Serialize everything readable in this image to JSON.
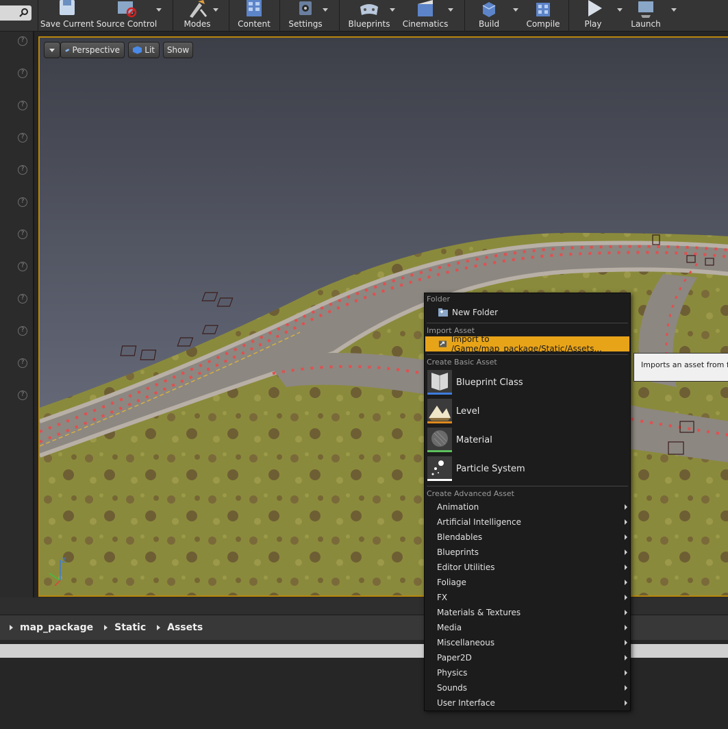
{
  "toolbar": {
    "buttons": [
      {
        "label": "Save Current"
      },
      {
        "label": "Source Control"
      },
      {
        "label": "Modes"
      },
      {
        "label": "Content"
      },
      {
        "label": "Settings"
      },
      {
        "label": "Blueprints"
      },
      {
        "label": "Cinematics"
      },
      {
        "label": "Build"
      },
      {
        "label": "Compile"
      },
      {
        "label": "Play"
      },
      {
        "label": "Launch"
      }
    ]
  },
  "left_panel": {
    "help_glyph": "?"
  },
  "viewport": {
    "view_mode_label": "Perspective",
    "lighting_label": "Lit",
    "show_label": "Show",
    "axis_z_label": "Z"
  },
  "breadcrumb": {
    "items": [
      "map_package",
      "Static",
      "Assets"
    ]
  },
  "context_menu": {
    "folder_heading": "Folder",
    "new_folder_label": "New Folder",
    "import_heading": "Import Asset",
    "import_label": "Import to /Game/map_package/Static/Assets...",
    "basic_heading": "Create Basic Asset",
    "basic_items": [
      {
        "label": "Blueprint Class",
        "bar_color": "#3d7ce0"
      },
      {
        "label": "Level",
        "bar_color": "#e08a1c"
      },
      {
        "label": "Material",
        "bar_color": "#5cc15c"
      },
      {
        "label": "Particle System",
        "bar_color": "#ffffff"
      }
    ],
    "advanced_heading": "Create Advanced Asset",
    "advanced_items": [
      "Animation",
      "Artificial Intelligence",
      "Blendables",
      "Blueprints",
      "Editor Utilities",
      "Foliage",
      "FX",
      "Materials & Textures",
      "Media",
      "Miscellaneous",
      "Paper2D",
      "Physics",
      "Sounds",
      "User Interface"
    ]
  },
  "tooltip": {
    "text": "Imports an asset from file"
  },
  "colors": {
    "highlight": "#e8a418",
    "viewport_border": "#b8860b",
    "sky_top": "#4a4e5a",
    "ground": "#8d8a3d",
    "road": "#8c8781",
    "spline_dots": "#e05050"
  }
}
